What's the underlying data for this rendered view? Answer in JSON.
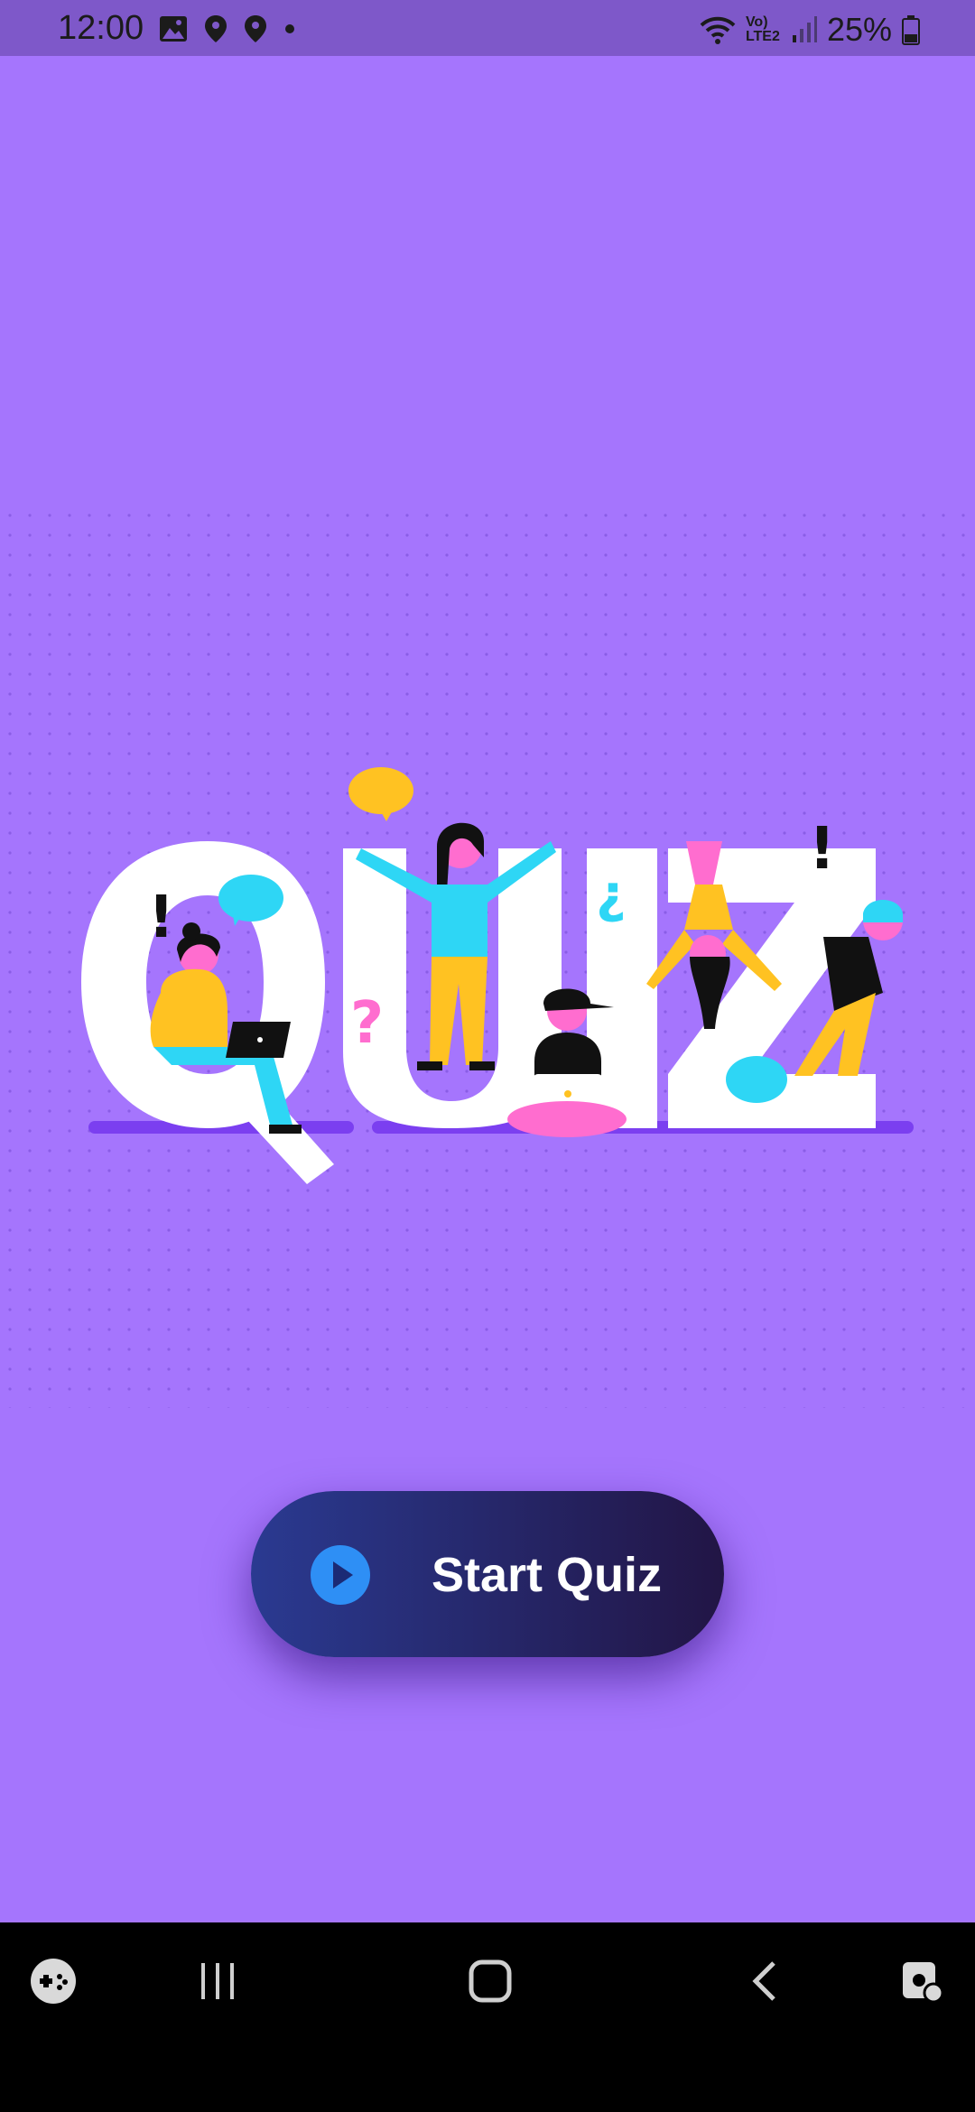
{
  "status_bar": {
    "time": "12:00",
    "network_label": "Vo) LTE2",
    "battery": "25%",
    "icons_left": [
      "gallery-icon",
      "location-icon",
      "location-icon",
      "dot-icon"
    ],
    "icons_right": [
      "wifi-icon",
      "lte-icon",
      "signal-icon",
      "battery-icon"
    ]
  },
  "hero": {
    "title_text": "QUIZ",
    "icon": "quiz-illustration"
  },
  "start_button": {
    "label": "Start Quiz",
    "icon": "play-icon",
    "color_start": "#2a3a91",
    "color_end": "#221545"
  },
  "nav_bar": {
    "items": [
      "game-launcher-icon",
      "recents-icon",
      "home-icon",
      "back-icon",
      "assistant-icon"
    ]
  },
  "colors": {
    "background": "#a575fd",
    "status_bar": "#7e58c9",
    "accent_blue": "#2e8ff5"
  }
}
